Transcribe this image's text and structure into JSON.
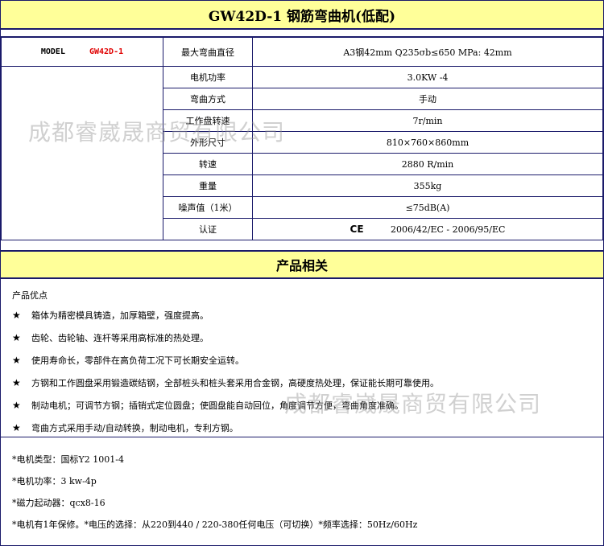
{
  "title": "GW42D-1 钢筋弯曲机(低配)",
  "model": {
    "label": "MODEL",
    "value": "GW42D-1"
  },
  "specs": [
    {
      "label": "最大弯曲直径",
      "value": "A3钢42mm  Q235σb≤650 MPa: 42mm"
    },
    {
      "label": "电机功率",
      "value": "3.0KW -4"
    },
    {
      "label": "弯曲方式",
      "value": "手动"
    },
    {
      "label": "工作盘转速",
      "value": "7r/min"
    },
    {
      "label": "外形尺寸",
      "value": "810×760×860mm"
    },
    {
      "label": "转速",
      "value": "2880 R/min"
    },
    {
      "label": "重量",
      "value": "355kg"
    },
    {
      "label": "噪声值（1米）",
      "value": "≤75dB(A)"
    },
    {
      "label": "认证",
      "mark": "CE",
      "value": "2006/42/EC  -  2006/95/EC"
    }
  ],
  "section_title": "产品相关",
  "advantages_title": "产品优点",
  "bullet": "★",
  "advantages": [
    "箱体为精密模具铸造，加厚箱壁，强度提高。",
    "齿轮、齿轮轴、连杆等采用高标准的热处理。",
    "使用寿命长，零部件在高负荷工况下可长期安全运转。",
    "方钢和工作圆盘采用锻造碳结钢，全部桩头和桩头套采用合金钢，高硬度热处理，保证能长期可靠使用。",
    "制动电机；可调节方钢；插销式定位圆盘；使圆盘能自动回位，角度调节方便，弯曲角度准确。",
    "弯曲方式采用手动/自动转换，制动电机，专利方钢。"
  ],
  "notes": [
    "*电机类型：国标Y2 1001-4",
    "*电机功率：3 kw-4p",
    "*磁力起动器：qcx8-16",
    "*电机有1年保修。*电压的选择：从220到440 / 220-380任何电压（可切换）*频率选择：50Hz/60Hz"
  ],
  "watermark": "成都睿崴晟商贸有限公司"
}
